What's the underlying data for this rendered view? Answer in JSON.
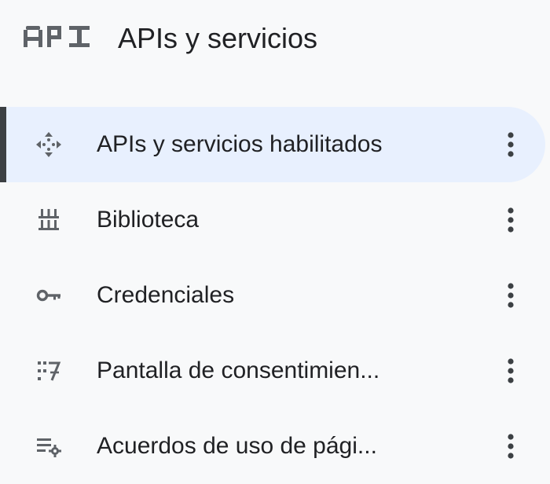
{
  "header": {
    "logo_text": "API",
    "title": "APIs y servicios"
  },
  "nav": {
    "items": [
      {
        "label": "APIs y servicios habilitados",
        "icon": "move-arrows-icon",
        "active": true
      },
      {
        "label": "Biblioteca",
        "icon": "library-icon",
        "active": false
      },
      {
        "label": "Credenciales",
        "icon": "key-icon",
        "active": false
      },
      {
        "label": "Pantalla de consentimien...",
        "icon": "consent-screen-icon",
        "active": false
      },
      {
        "label": "Acuerdos de uso de pági...",
        "icon": "page-usage-agreements-icon",
        "active": false
      }
    ]
  },
  "colors": {
    "background": "#f8f9fa",
    "active_background": "#e8f0fe",
    "active_indicator": "#3c4043",
    "text": "#202124",
    "icon": "#5f6368"
  }
}
